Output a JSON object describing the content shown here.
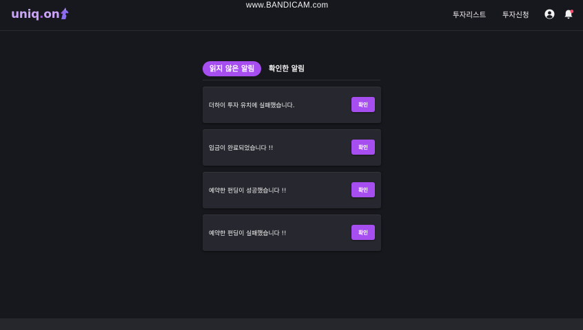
{
  "header": {
    "logo_main": "uniq",
    "logo_dot": ".",
    "logo_end": "on",
    "watermark": "www.BANDICAM.com",
    "nav": [
      "투자리스트",
      "투자신청"
    ],
    "icons": [
      "user-circle-icon",
      "bell-icon"
    ]
  },
  "tabs": {
    "unread_label": "읽지 않은 알림",
    "read_label": "확인한 알림"
  },
  "notifications": [
    {
      "message": "더하이 투자 유치에 실패했습니다.",
      "button": "확인"
    },
    {
      "message": "입금이 완료되었습니다 !!",
      "button": "확인"
    },
    {
      "message": "예약한 펀딩이 성공했습니다 !!",
      "button": "확인"
    },
    {
      "message": "예약한 펀딩이 실패했습니다 !!",
      "button": "확인"
    }
  ],
  "colors": {
    "background": "#17181d",
    "accent": "#a64ef0",
    "card": "#27282f",
    "notification_dot": "#ff4d6d"
  }
}
